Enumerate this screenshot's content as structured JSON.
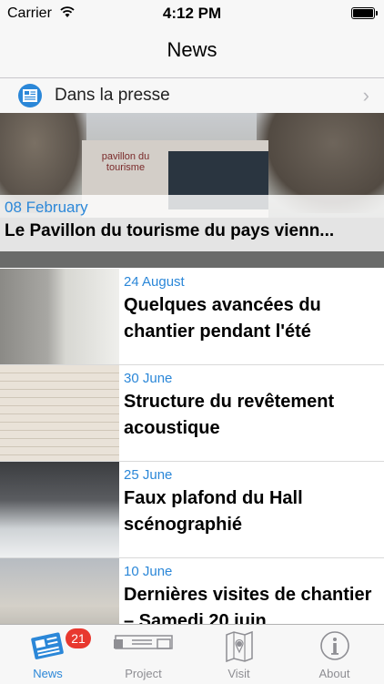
{
  "status_bar": {
    "carrier": "Carrier",
    "time": "4:12 PM"
  },
  "nav": {
    "title": "News"
  },
  "press": {
    "label": "Dans la presse",
    "icon": "newspaper-icon"
  },
  "hero": {
    "date": "08 February",
    "headline": "Le Pavillon du tourisme du pays vienn...",
    "sign": "pavillon du tourisme"
  },
  "news": [
    {
      "date": "24 August",
      "title": "Quelques avancées du chantier pendant l'été"
    },
    {
      "date": "30 June",
      "title": "Structure du revêtement acoustique"
    },
    {
      "date": "25 June",
      "title": "Faux plafond du Hall scénographié"
    },
    {
      "date": "10 June",
      "title": "Dernières visites de chantier – Samedi 20 juin"
    }
  ],
  "tabs": [
    {
      "label": "News",
      "icon": "newspaper-icon",
      "badge": "21",
      "active": true
    },
    {
      "label": "Project",
      "icon": "project-icon"
    },
    {
      "label": "Visit",
      "icon": "map-icon"
    },
    {
      "label": "About",
      "icon": "info-icon"
    }
  ],
  "colors": {
    "accent": "#2b87d8",
    "badge": "#e8382f"
  }
}
